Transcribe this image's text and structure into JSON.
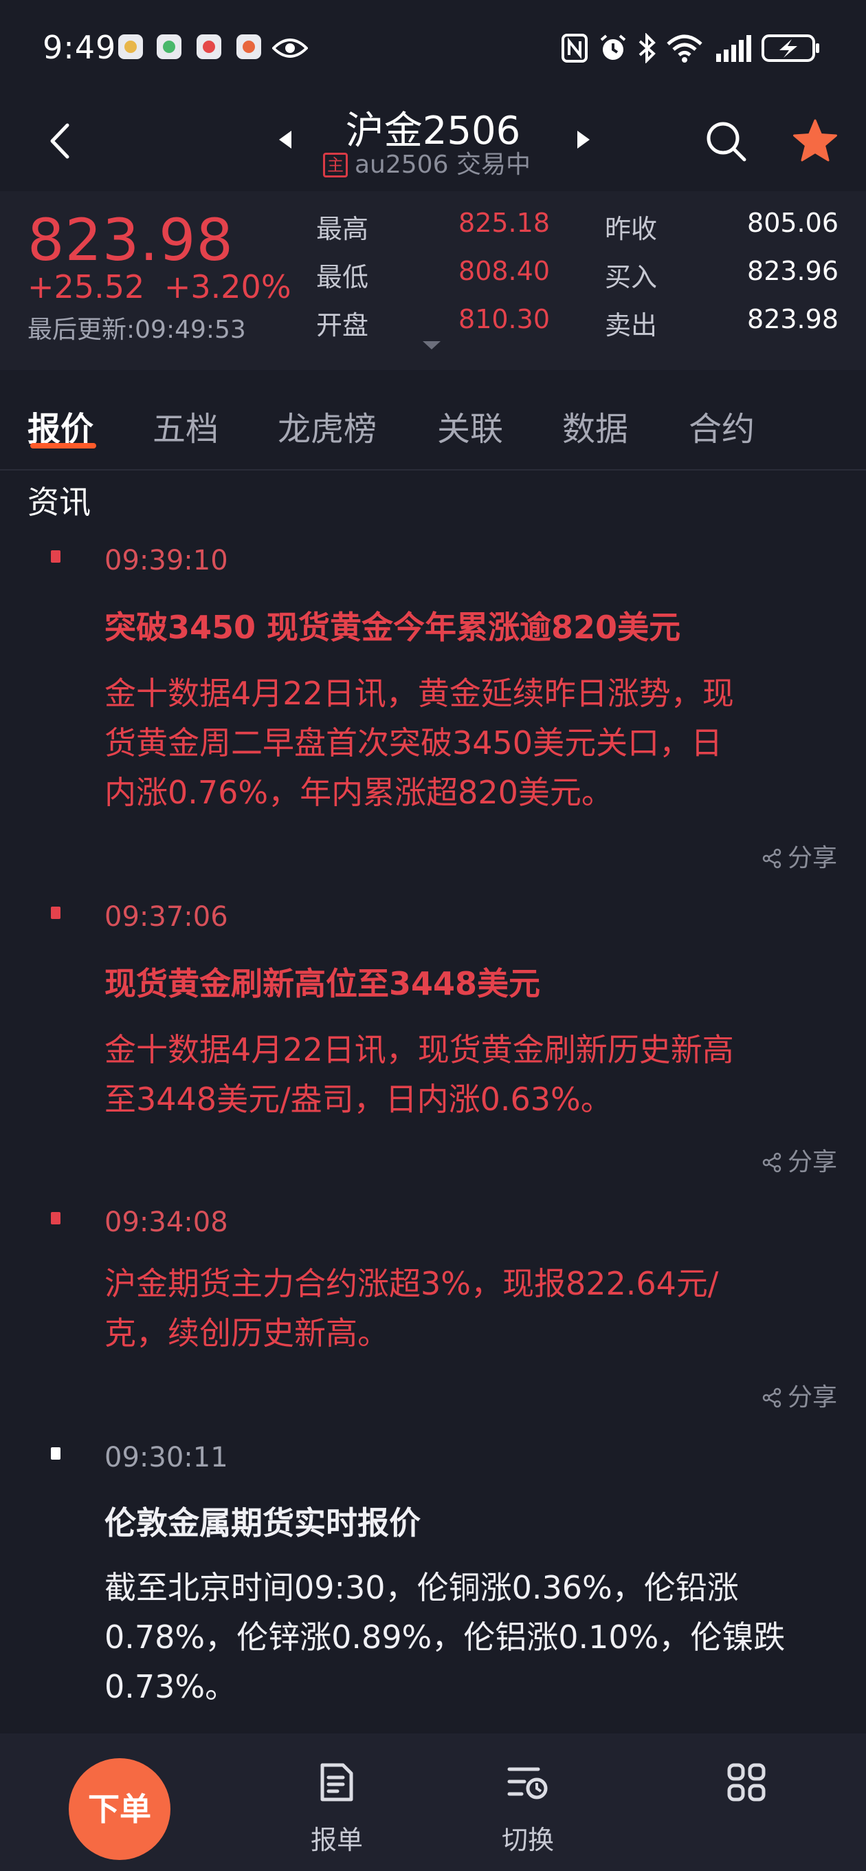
{
  "status_bar": {
    "time": "9:49"
  },
  "header": {
    "title": "沪金2506",
    "badge": "主",
    "subtitle": "au2506 交易中"
  },
  "quote": {
    "price": "823.98",
    "change": "+25.52",
    "change_pct": "+3.20%",
    "updated": "最后更新:09:49:53",
    "rows": [
      {
        "label1": "最高",
        "val1": "825.18",
        "label2": "昨收",
        "val2": "805.06"
      },
      {
        "label1": "最低",
        "val1": "808.40",
        "label2": "买入",
        "val2": "823.96"
      },
      {
        "label1": "开盘",
        "val1": "810.30",
        "label2": "卖出",
        "val2": "823.98"
      }
    ]
  },
  "tabs": [
    "报价",
    "五档",
    "龙虎榜",
    "关联",
    "数据",
    "合约"
  ],
  "section_title": "资讯",
  "news": [
    {
      "time": "09:39:10",
      "title": "突破3450 现货黄金今年累涨逾820美元",
      "body": [
        "金十数据4月22日讯，黄金延续昨日涨势，现",
        "货黄金周二早盘首次突破3450美元关口，日",
        "内涨0.76%，年内累涨超820美元。"
      ],
      "share": "分享",
      "color": "#e4424c"
    },
    {
      "time": "09:37:06",
      "title": "现货黄金刷新高位至3448美元",
      "body": [
        "金十数据4月22日讯，现货黄金刷新历史新高",
        "至3448美元/盎司，日内涨0.63%。"
      ],
      "share": "分享",
      "color": "#e4424c"
    },
    {
      "time": "09:34:08",
      "title": "",
      "body": [
        "沪金期货主力合约涨超3%，现报822.64元/",
        "克，续创历史新高。"
      ],
      "share": "分享",
      "color": "#e4424c"
    },
    {
      "time": "09:30:11",
      "title": "伦敦金属期货实时报价",
      "body": [
        "截至北京时间09:30，伦铜涨0.36%，伦铅涨",
        "0.78%，伦锌涨0.89%，伦铝涨0.10%，伦镍跌",
        "0.73%。"
      ],
      "share": "分享",
      "color": "#f0f0f4"
    }
  ],
  "bottom_nav": {
    "order": "下单",
    "items": [
      "报单",
      "切换"
    ]
  },
  "colors": {
    "up_red": "#e4424c",
    "accent_orange": "#ff5b2a",
    "star": "#f66a43"
  }
}
